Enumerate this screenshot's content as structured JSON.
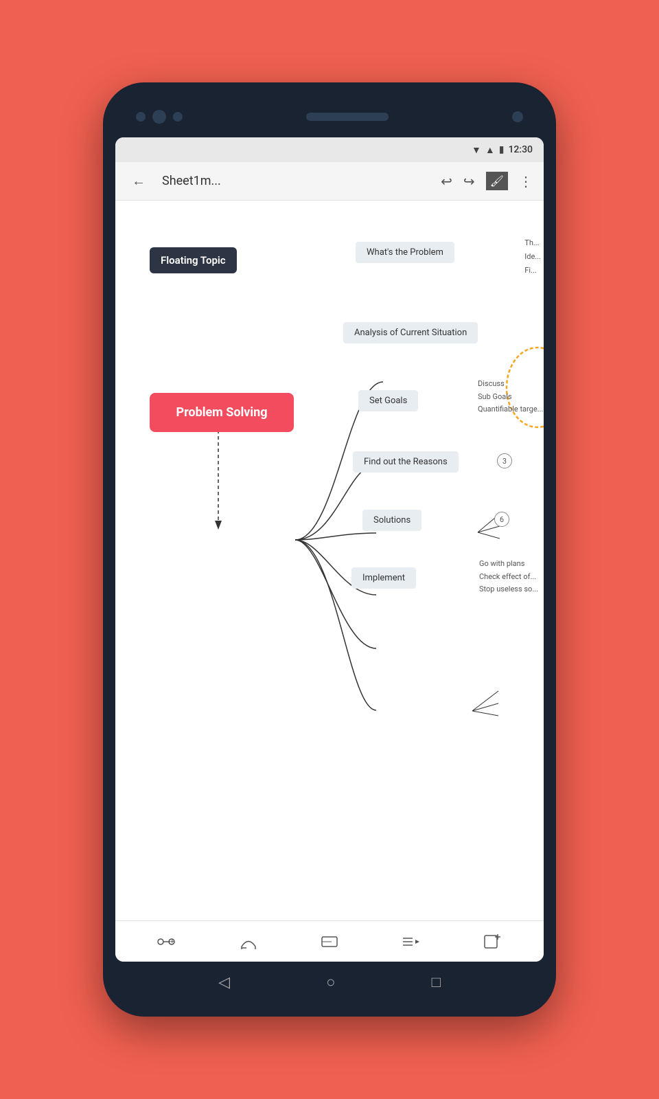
{
  "status": {
    "time": "12:30",
    "wifi": "▼",
    "signal": "▲",
    "battery": "🔋"
  },
  "toolbar": {
    "title": "Sheet1m...",
    "back_label": "←",
    "undo_label": "↩",
    "redo_label": "↪",
    "format_painter_label": "🖌",
    "more_label": "⋮"
  },
  "mindmap": {
    "floating_topic": "Floating Topic",
    "central_node": "Problem Solving",
    "branches": [
      {
        "label": "What's the Problem",
        "id": "whats-problem"
      },
      {
        "label": "Analysis of Current Situation",
        "id": "analysis"
      },
      {
        "label": "Set Goals",
        "id": "set-goals"
      },
      {
        "label": "Find out the Reasons",
        "id": "find-reasons"
      },
      {
        "label": "Solutions",
        "id": "solutions"
      },
      {
        "label": "Implement",
        "id": "implement"
      }
    ],
    "set_goals_children": [
      "Discuss",
      "Sub Goals",
      "Quantifiable targe..."
    ],
    "find_reasons_badge": "3",
    "solutions_badge": "6",
    "implement_children": [
      "Go with plans",
      "Check effect of...",
      "Stop useless so..."
    ],
    "partial_items": [
      "Th...",
      "Ide...",
      "Fi..."
    ]
  },
  "bottom_tools": [
    {
      "label": "⊕",
      "name": "add-node-tool"
    },
    {
      "label": "⌒",
      "name": "connector-tool"
    },
    {
      "label": "▭",
      "name": "shape-tool"
    },
    {
      "label": "≡▶",
      "name": "layout-tool"
    },
    {
      "label": "⊕",
      "name": "add-element-tool"
    }
  ],
  "nav": {
    "back": "◁",
    "home": "○",
    "recent": "□"
  }
}
